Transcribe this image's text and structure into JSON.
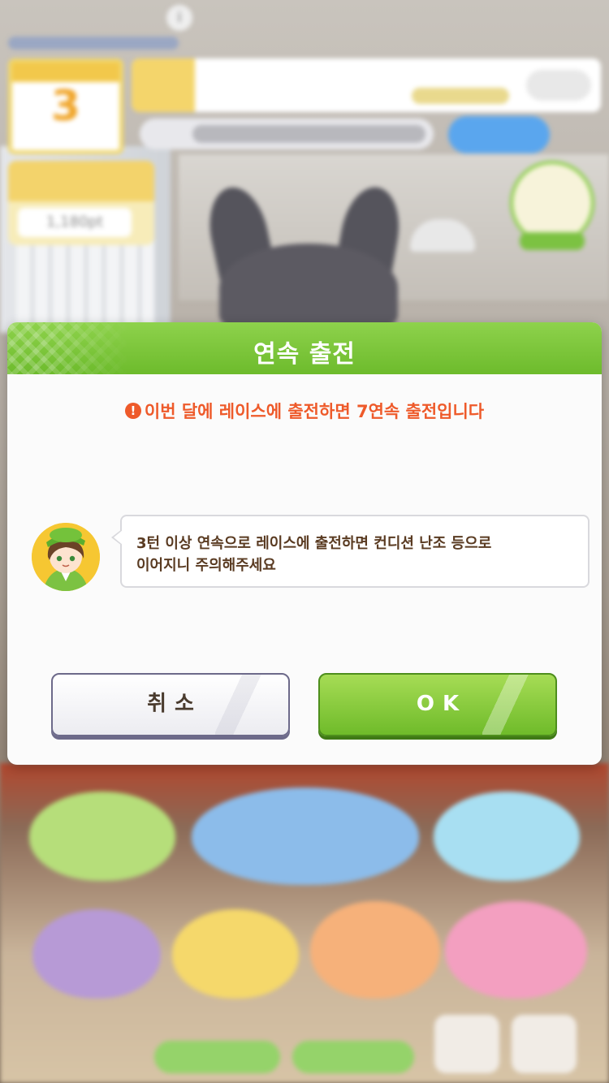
{
  "dialog": {
    "title": "연속 출전",
    "warning": "이번 달에 레이스에 출전하면 7연속 출전입니다",
    "warning_icon": "exclamation-circle-icon",
    "message_line1": "3턴 이상 연속으로 레이스에 출전하면 컨디션 난조 등으로",
    "message_line2": "이어지니 주의해주세요",
    "cancel_label": "취소",
    "ok_label": "OK"
  },
  "background_hud": {
    "turns_left_number": "3",
    "fans_value": "1,180pt"
  },
  "colors": {
    "header_green": "#7cc43a",
    "warning_orange": "#ee5a2a",
    "message_brown": "#5a3b22",
    "ok_green": "#8ccf40"
  }
}
